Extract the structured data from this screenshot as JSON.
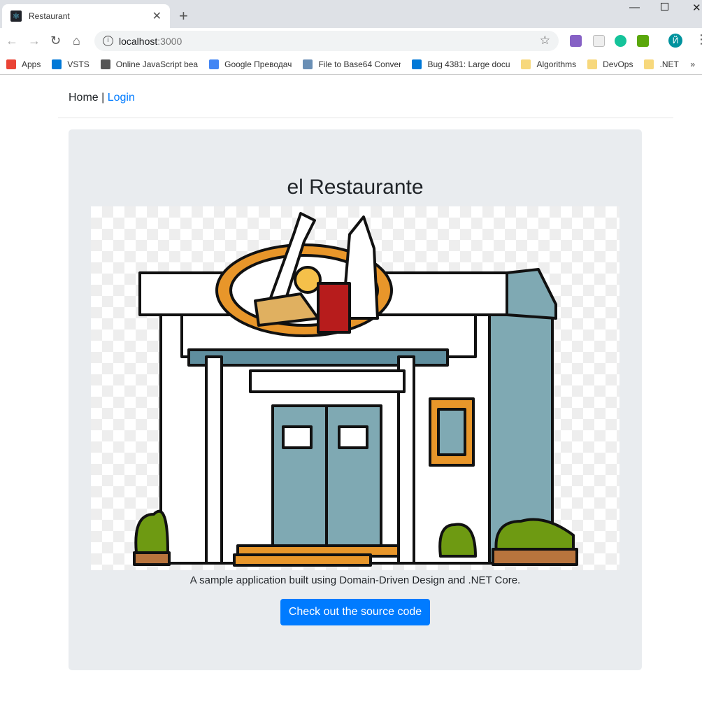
{
  "browser": {
    "tab_title": "Restaurant",
    "new_tab": "+",
    "url_host": "localhost",
    "url_port": ":3000",
    "profile_initial": "Й",
    "bookmarks": [
      {
        "label": "Apps",
        "color": "#ea4335"
      },
      {
        "label": "VSTS",
        "color": "#0078d7"
      },
      {
        "label": "Online JavaScript bea",
        "color": "#555555"
      },
      {
        "label": "Google Преводач",
        "color": "#4285f4"
      },
      {
        "label": "File to Base64 Conver",
        "color": "#6a8fb5"
      },
      {
        "label": "Bug 4381: Large docu",
        "color": "#0078d7"
      },
      {
        "label": "Algorithms",
        "color": "#f7d87c"
      },
      {
        "label": "DevOps",
        "color": "#f7d87c"
      },
      {
        "label": ".NET",
        "color": "#f7d87c"
      }
    ],
    "more": "»"
  },
  "nav": {
    "home": "Home",
    "separator": " | ",
    "login": "Login"
  },
  "jumbotron": {
    "title": "el Restaurante",
    "caption": "A sample application built using Domain-Driven Design and .NET Core.",
    "button": "Check out the source code"
  },
  "colors": {
    "primary": "#007bff",
    "jumbotron": "#e9ecef"
  }
}
